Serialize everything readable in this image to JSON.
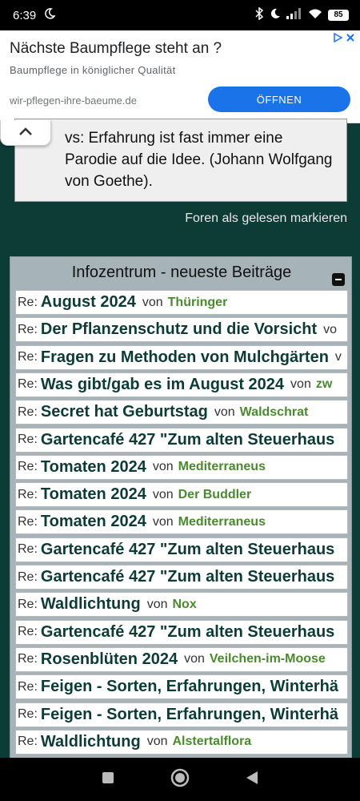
{
  "status_bar": {
    "time": "6:39",
    "battery": "85"
  },
  "ad": {
    "title": "Nächste Baumpflege steht an ?",
    "subtitle": "Baumpflege in königlicher Qualität",
    "url": "wir-pflegen-ihre-baeume.de",
    "button": "ÖFFNEN"
  },
  "quote": {
    "text": "vs: Erfahrung ist fast immer eine Parodie auf die Idee. (Johann Wolfgang von Goethe)."
  },
  "forum_link": "Foren als gelesen markieren",
  "panel": {
    "title": "Infozentrum - neueste Beiträge",
    "rows": [
      {
        "prefix": "Re:",
        "topic": "August 2024",
        "von": "von",
        "author": "Thüringer"
      },
      {
        "prefix": "Re:",
        "topic": "Der Pflanzenschutz und die Vorsicht",
        "von": "vo",
        "author": ""
      },
      {
        "prefix": "Re:",
        "topic": "Fragen zu Methoden von Mulchgärten",
        "von": "v",
        "author": ""
      },
      {
        "prefix": "Re:",
        "topic": "Was gibt/gab es im August 2024",
        "von": "von",
        "author": "zw"
      },
      {
        "prefix": "Re:",
        "topic": "Secret hat Geburtstag",
        "von": "von",
        "author": "Waldschrat"
      },
      {
        "prefix": "Re:",
        "topic": "Gartencafé 427 \"Zum alten Steuerhaus",
        "von": "",
        "author": ""
      },
      {
        "prefix": "Re:",
        "topic": "Tomaten 2024",
        "von": "von",
        "author": "Mediterraneus"
      },
      {
        "prefix": "Re:",
        "topic": "Tomaten 2024",
        "von": "von",
        "author": "Der Buddler"
      },
      {
        "prefix": "Re:",
        "topic": "Tomaten 2024",
        "von": "von",
        "author": "Mediterraneus"
      },
      {
        "prefix": "Re:",
        "topic": "Gartencafé 427 \"Zum alten Steuerhaus",
        "von": "",
        "author": ""
      },
      {
        "prefix": "Re:",
        "topic": "Gartencafé 427 \"Zum alten Steuerhaus",
        "von": "",
        "author": ""
      },
      {
        "prefix": "Re:",
        "topic": "Waldlichtung",
        "von": "von",
        "author": "Nox"
      },
      {
        "prefix": "Re:",
        "topic": "Gartencafé 427 \"Zum alten Steuerhaus",
        "von": "",
        "author": ""
      },
      {
        "prefix": "Re:",
        "topic": "Rosenblüten 2024",
        "von": "von",
        "author": "Veilchen-im-Moose"
      },
      {
        "prefix": "Re:",
        "topic": "Feigen - Sorten, Erfahrungen, Winterhä",
        "von": "",
        "author": ""
      },
      {
        "prefix": "Re:",
        "topic": "Feigen - Sorten, Erfahrungen, Winterhä",
        "von": "",
        "author": ""
      },
      {
        "prefix": "Re:",
        "topic": "Waldlichtung",
        "von": "von",
        "author": "Alstertalflora"
      }
    ]
  },
  "colors": {
    "background": "#0d3b36",
    "topic": "#0d3b36",
    "author": "#4a8a2e",
    "ad_button": "#1a73e8"
  },
  "icons": [
    "moon-icon",
    "bluetooth-icon",
    "do-not-disturb-icon",
    "signal-icon",
    "wifi-icon",
    "battery-icon",
    "adchoices-icon",
    "close-icon",
    "chevron-up-icon",
    "minus-icon",
    "recents-icon",
    "home-icon",
    "back-icon"
  ]
}
